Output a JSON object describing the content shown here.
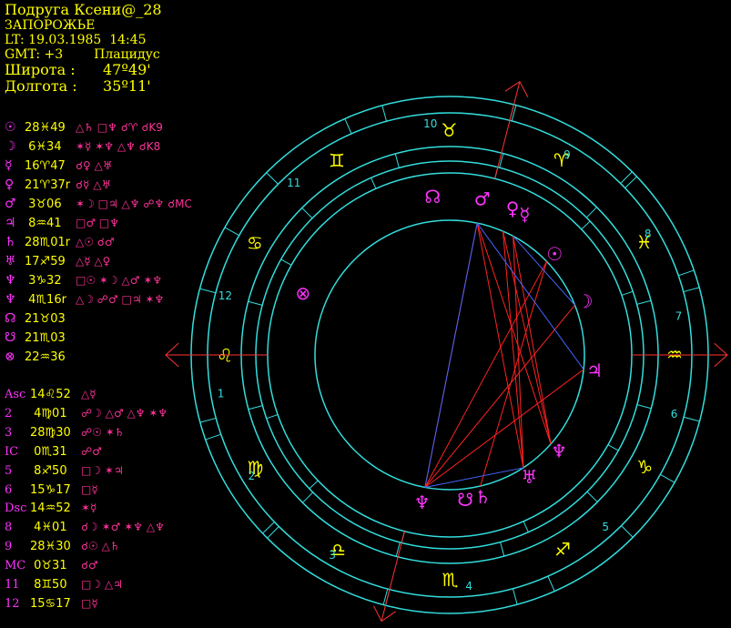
{
  "header": {
    "name": "Подруга Ксени@_28",
    "city": "ЗАПОРОЖЬЕ",
    "lt": "LT: 19.03.1985  14:45",
    "gmt": "GMT: +3",
    "system": "Плацидус",
    "lat_label": "Широта :",
    "lat_value": "47º49'",
    "lon_label": "Долгота :",
    "lon_value": "35º11'"
  },
  "planets": [
    {
      "glyph": "☉",
      "pos": "28♓49",
      "aspects": "△♄ □♆ ☌♈ ☌K9"
    },
    {
      "glyph": "☽",
      "pos": " 6♓34",
      "aspects": "✶☿ ✶♆ △♆ ☌K8"
    },
    {
      "glyph": "☿",
      "pos": "16♈47",
      "aspects": "☌♀ △♅"
    },
    {
      "glyph": "♀",
      "pos": "21♈37r",
      "aspects": "☌☿ △♅"
    },
    {
      "glyph": "♂",
      "pos": " 3♉06",
      "aspects": "✶☽ □♃ △♆ ☍♆ ☌MC"
    },
    {
      "glyph": "♃",
      "pos": " 8♒41",
      "aspects": "□♂ □♆"
    },
    {
      "glyph": "♄",
      "pos": "28♏01r",
      "aspects": "△☉ ☌♂"
    },
    {
      "glyph": "♅",
      "pos": "17♐59",
      "aspects": "△☿ △♀"
    },
    {
      "glyph": "♆",
      "pos": " 3♑32",
      "aspects": "□☉ ✶☽ △♂ ✶♆"
    },
    {
      "glyph": "♆",
      "pos": " 4♏16r",
      "aspects": "△☽ ☍♂ □♃ ✶♆"
    },
    {
      "glyph": "☊",
      "pos": "21♉03",
      "aspects": ""
    },
    {
      "glyph": "☋",
      "pos": "21♏03",
      "aspects": ""
    },
    {
      "glyph": "⊗",
      "pos": "22♒36",
      "aspects": ""
    }
  ],
  "houses": [
    {
      "label": "Asc",
      "pos": "14♌52",
      "aspects": "△☿"
    },
    {
      "label": "2",
      "pos": " 4♍01",
      "aspects": "☍☽ △♂ △♆ ✶♆"
    },
    {
      "label": "3",
      "pos": "28♍30",
      "aspects": "☍☉ ✶♄"
    },
    {
      "label": "IC",
      "pos": " 0♏31",
      "aspects": "☍♂"
    },
    {
      "label": "5",
      "pos": " 8♐50",
      "aspects": "□☽ ✶♃"
    },
    {
      "label": "6",
      "pos": "15♑17",
      "aspects": "□☿"
    },
    {
      "label": "Dsc",
      "pos": "14♒52",
      "aspects": "✶☿"
    },
    {
      "label": "8",
      "pos": " 4♓01",
      "aspects": "☌☽ ✶♂ ✶♆ △♆"
    },
    {
      "label": "9",
      "pos": "28♓30",
      "aspects": "☌☉ △♄"
    },
    {
      "label": "MC",
      "pos": " 0♉31",
      "aspects": "☌♂"
    },
    {
      "label": "11",
      "pos": " 8♊50",
      "aspects": "□☽ △♃"
    },
    {
      "label": "12",
      "pos": "15♋17",
      "aspects": "□☿"
    }
  ],
  "wheel": {
    "signs": [
      "♈",
      "♉",
      "♊",
      "♋",
      "♌",
      "♍",
      "♎",
      "♏",
      "♐",
      "♑",
      "♒",
      "♓"
    ],
    "house_numbers": [
      "1",
      "2",
      "3",
      "4",
      "5",
      "6",
      "7",
      "8",
      "9",
      "10",
      "11",
      "12"
    ],
    "planet_glyphs": [
      {
        "g": "☉",
        "lon": 358.8
      },
      {
        "g": "☽",
        "lon": 336.6
      },
      {
        "g": "☿",
        "lon": 16.8
      },
      {
        "g": "♀",
        "lon": 21.6
      },
      {
        "g": "♂",
        "lon": 33.1
      },
      {
        "g": "♃",
        "lon": 308.7
      },
      {
        "g": "♄",
        "lon": 238.0
      },
      {
        "g": "♅",
        "lon": 258.0
      },
      {
        "g": "♆",
        "lon": 273.5
      },
      {
        "g": "♆",
        "lon": 214.3
      },
      {
        "g": "☊",
        "lon": 51.0
      },
      {
        "g": "☋",
        "lon": 231.0
      },
      {
        "g": "⊗",
        "lon": 112.0
      }
    ],
    "colors": {
      "ring": "#33dddd",
      "sign": "#ffff00",
      "planet": "#ff33ff",
      "house": "#33dddd",
      "axis": "#ff3333",
      "aspect_red": "#ff2222",
      "aspect_blue": "#4466ff"
    }
  }
}
